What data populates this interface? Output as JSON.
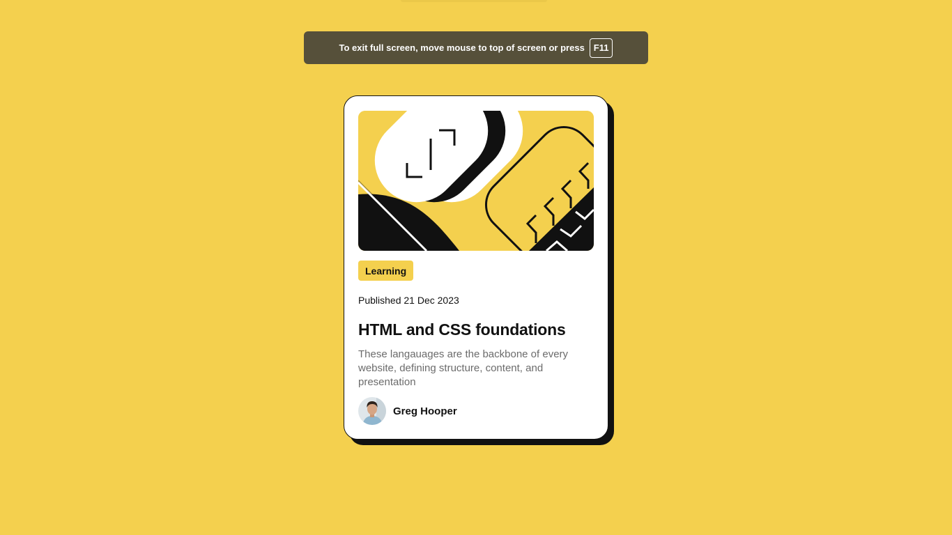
{
  "fullscreen_banner": {
    "message": "To exit full screen, move mouse to top of screen or press",
    "key": "F11"
  },
  "card": {
    "tag": "Learning",
    "published": "Published 21 Dec 2023",
    "title": "HTML and CSS foundations",
    "description": "These langauages are the backbone of every website, defining structure, content, and presentation",
    "author": {
      "name": "Greg Hooper"
    }
  },
  "colors": {
    "background": "#f4d04e",
    "card": "#ffffff",
    "ink": "#111111",
    "muted_text": "#6b6b6b",
    "banner": "#56503a"
  }
}
